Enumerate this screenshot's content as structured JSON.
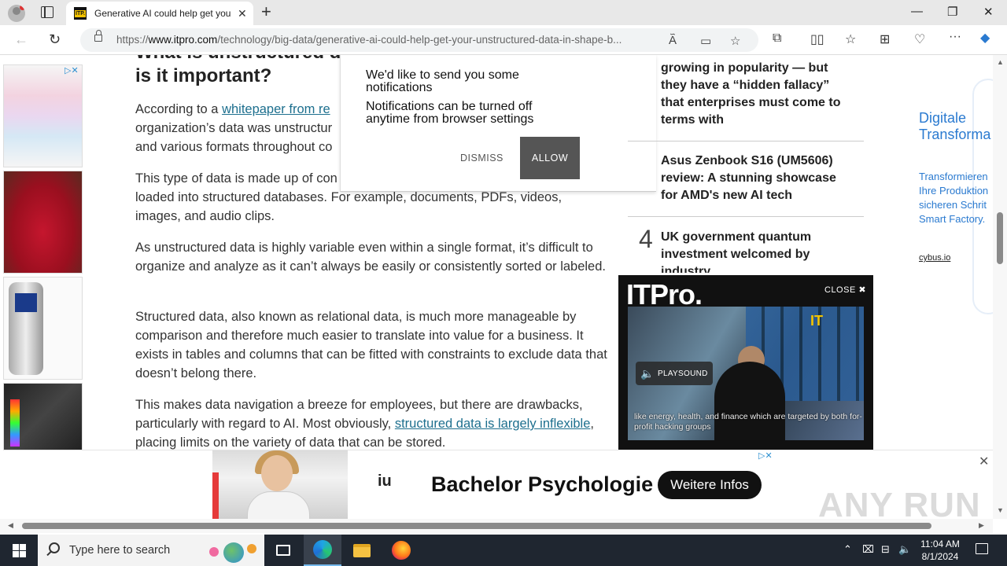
{
  "browser": {
    "tab_title": "Generative AI could help get your unstructured data in shape",
    "tab_favicon": "ITP.",
    "url_prefix": "https://",
    "url_domain": "www.itpro.com",
    "url_path": "/technology/big-data/generative-ai-could-help-get-your-unstructured-data-in-shape-b...",
    "icons": [
      "profile-icon",
      "tabs-icon",
      "close-icon",
      "plus-icon",
      "minimize-icon",
      "maximize-icon",
      "back-icon",
      "refresh-icon",
      "lock-icon",
      "read-aloud-icon",
      "immersive-reader-icon",
      "favorite-star-icon",
      "extensions-icon",
      "split-screen-icon",
      "favorites-icon",
      "collections-icon",
      "performance-icon",
      "more-icon",
      "copilot-icon"
    ]
  },
  "article": {
    "heading": "What is unstructured data, and why is it important?",
    "paragraphs": [
      {
        "before": "According to a ",
        "link": "whitepaper from re",
        "after": ""
      },
      {
        "text": "organization’s data was unstructur"
      },
      {
        "text": "and various formats throughout co"
      },
      {
        "text": "This type of data is made up of con"
      },
      {
        "text": "loaded into structured databases. For example, documents, PDFs, videos,"
      },
      {
        "text": "images, and audio clips."
      },
      {
        "text": "As unstructured data is highly variable even within a single format, it’s difficult to organize and analyze as it can’t always be easily or consistently sorted or labeled."
      },
      {
        "text": "Structured data, also known as relational data, is much more manageable by comparison and therefore much easier to translate into value for a business. It exists in tables and columns that can be fitted with constraints to exclude data that doesn’t belong there."
      },
      {
        "before": "This makes data navigation a breeze for employees, but there are drawbacks, particularly with regard to AI. Most obviously, ",
        "link": "structured data is largely inflexible",
        "after": ", placing limits on the variety of data that can be stored."
      }
    ]
  },
  "notification": {
    "message1": "We'd like to send you some notifications",
    "message2": "Notifications can be turned off anytime from browser settings",
    "dismiss": "DISMISS",
    "allow": "ALLOW"
  },
  "sidebar": {
    "item1": "growing in popularity — but they have a “hidden fallacy” that enterprises must come to terms with",
    "item2": "Asus Zenbook S16 (UM5606) review: A stunning showcase for AMD's new AI tech",
    "item3_number": "4",
    "item3": "UK government quantum investment welcomed by industry"
  },
  "video": {
    "logo": "ITPro.",
    "close_label": "CLOSE",
    "playsound": "PLAYSOUND",
    "frame_mark": "IT",
    "caption": "like energy, health, and finance which are targeted by both for-profit hacking groups"
  },
  "right_ad": {
    "title_line1": "Digitale",
    "title_line2": "Transforma",
    "text_lines": [
      "Transformieren",
      "Ihre Produktion",
      "sicheren Schrit",
      "Smart Factory."
    ],
    "link": "cybus.io"
  },
  "bottom_ad": {
    "logo": "iu",
    "title": "Bachelor Psychologie",
    "button": "Weitere Infos"
  },
  "watermark": "ANY RUN",
  "taskbar": {
    "search_placeholder": "Type here to search",
    "time": "11:04 AM",
    "date": "8/1/2024"
  }
}
